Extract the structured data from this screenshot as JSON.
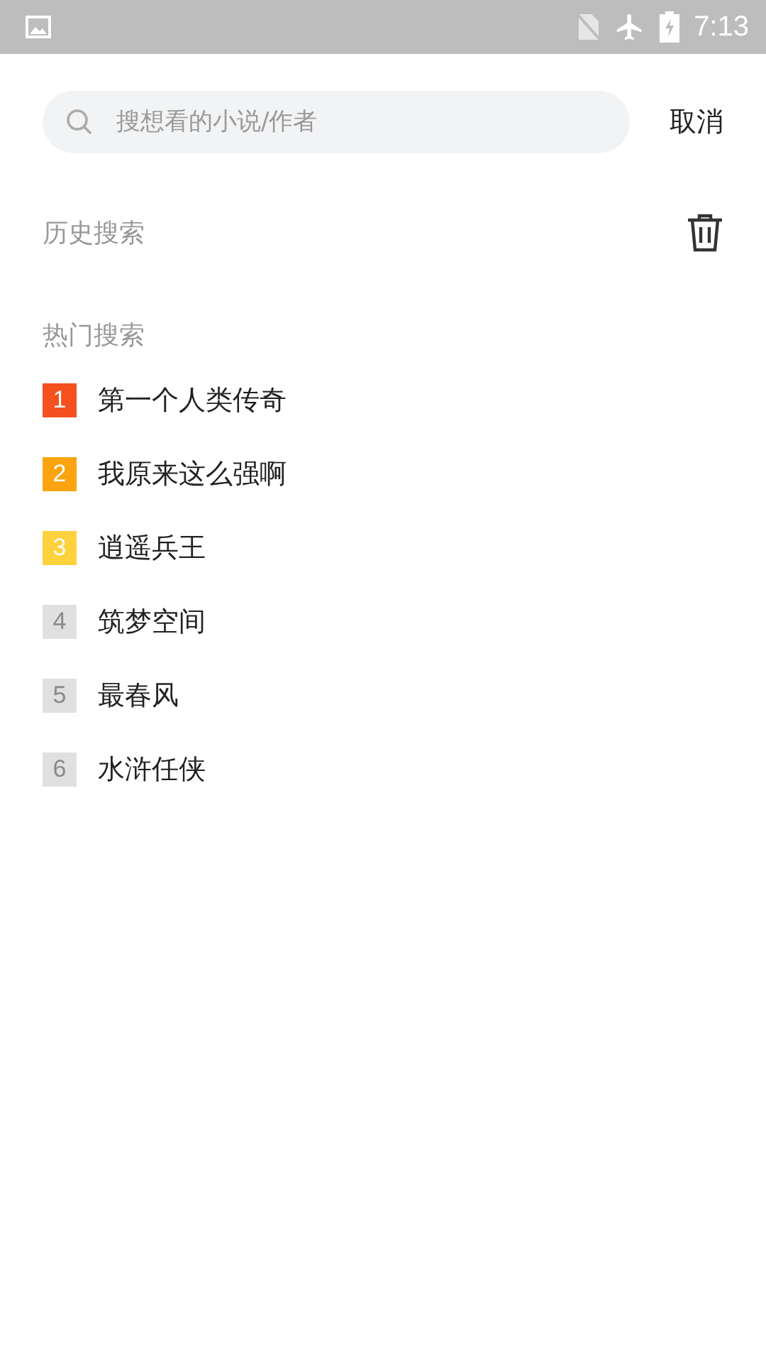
{
  "status_bar": {
    "time": "7:13"
  },
  "search": {
    "placeholder": "搜想看的小说/作者",
    "cancel": "取消"
  },
  "history": {
    "title": "历史搜索"
  },
  "hot": {
    "title": "热门搜索",
    "items": [
      {
        "rank": "1",
        "title": "第一个人类传奇",
        "color": "#f4511e"
      },
      {
        "rank": "2",
        "title": "我原来这么强啊",
        "color": "#fba40f"
      },
      {
        "rank": "3",
        "title": "逍遥兵王",
        "color": "#fdd23c"
      },
      {
        "rank": "4",
        "title": "筑梦空间",
        "color": "#e0e0e0"
      },
      {
        "rank": "5",
        "title": "最春风",
        "color": "#e0e0e0"
      },
      {
        "rank": "6",
        "title": "水浒任侠",
        "color": "#e0e0e0"
      }
    ]
  }
}
